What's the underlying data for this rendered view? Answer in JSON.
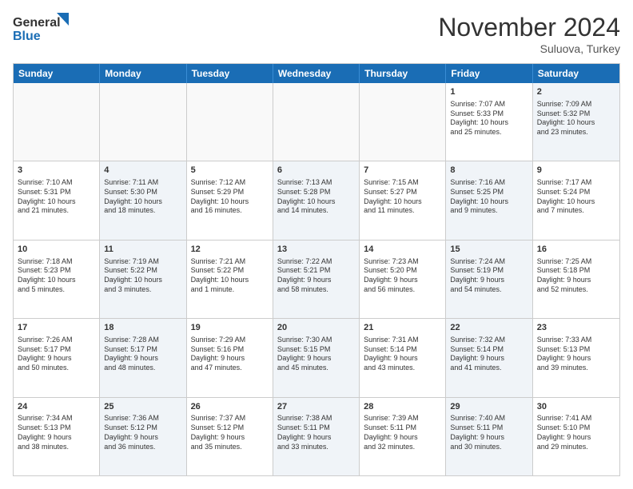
{
  "logo": {
    "line1": "General",
    "line2": "Blue"
  },
  "header": {
    "month": "November 2024",
    "location": "Suluova, Turkey"
  },
  "weekdays": [
    "Sunday",
    "Monday",
    "Tuesday",
    "Wednesday",
    "Thursday",
    "Friday",
    "Saturday"
  ],
  "rows": [
    [
      {
        "day": "",
        "info": "",
        "empty": true
      },
      {
        "day": "",
        "info": "",
        "empty": true
      },
      {
        "day": "",
        "info": "",
        "empty": true
      },
      {
        "day": "",
        "info": "",
        "empty": true
      },
      {
        "day": "",
        "info": "",
        "empty": true
      },
      {
        "day": "1",
        "info": "Sunrise: 7:07 AM\nSunset: 5:33 PM\nDaylight: 10 hours\nand 25 minutes.",
        "empty": false,
        "alt": false
      },
      {
        "day": "2",
        "info": "Sunrise: 7:09 AM\nSunset: 5:32 PM\nDaylight: 10 hours\nand 23 minutes.",
        "empty": false,
        "alt": true
      }
    ],
    [
      {
        "day": "3",
        "info": "Sunrise: 7:10 AM\nSunset: 5:31 PM\nDaylight: 10 hours\nand 21 minutes.",
        "empty": false,
        "alt": false
      },
      {
        "day": "4",
        "info": "Sunrise: 7:11 AM\nSunset: 5:30 PM\nDaylight: 10 hours\nand 18 minutes.",
        "empty": false,
        "alt": true
      },
      {
        "day": "5",
        "info": "Sunrise: 7:12 AM\nSunset: 5:29 PM\nDaylight: 10 hours\nand 16 minutes.",
        "empty": false,
        "alt": false
      },
      {
        "day": "6",
        "info": "Sunrise: 7:13 AM\nSunset: 5:28 PM\nDaylight: 10 hours\nand 14 minutes.",
        "empty": false,
        "alt": true
      },
      {
        "day": "7",
        "info": "Sunrise: 7:15 AM\nSunset: 5:27 PM\nDaylight: 10 hours\nand 11 minutes.",
        "empty": false,
        "alt": false
      },
      {
        "day": "8",
        "info": "Sunrise: 7:16 AM\nSunset: 5:25 PM\nDaylight: 10 hours\nand 9 minutes.",
        "empty": false,
        "alt": true
      },
      {
        "day": "9",
        "info": "Sunrise: 7:17 AM\nSunset: 5:24 PM\nDaylight: 10 hours\nand 7 minutes.",
        "empty": false,
        "alt": false
      }
    ],
    [
      {
        "day": "10",
        "info": "Sunrise: 7:18 AM\nSunset: 5:23 PM\nDaylight: 10 hours\nand 5 minutes.",
        "empty": false,
        "alt": false
      },
      {
        "day": "11",
        "info": "Sunrise: 7:19 AM\nSunset: 5:22 PM\nDaylight: 10 hours\nand 3 minutes.",
        "empty": false,
        "alt": true
      },
      {
        "day": "12",
        "info": "Sunrise: 7:21 AM\nSunset: 5:22 PM\nDaylight: 10 hours\nand 1 minute.",
        "empty": false,
        "alt": false
      },
      {
        "day": "13",
        "info": "Sunrise: 7:22 AM\nSunset: 5:21 PM\nDaylight: 9 hours\nand 58 minutes.",
        "empty": false,
        "alt": true
      },
      {
        "day": "14",
        "info": "Sunrise: 7:23 AM\nSunset: 5:20 PM\nDaylight: 9 hours\nand 56 minutes.",
        "empty": false,
        "alt": false
      },
      {
        "day": "15",
        "info": "Sunrise: 7:24 AM\nSunset: 5:19 PM\nDaylight: 9 hours\nand 54 minutes.",
        "empty": false,
        "alt": true
      },
      {
        "day": "16",
        "info": "Sunrise: 7:25 AM\nSunset: 5:18 PM\nDaylight: 9 hours\nand 52 minutes.",
        "empty": false,
        "alt": false
      }
    ],
    [
      {
        "day": "17",
        "info": "Sunrise: 7:26 AM\nSunset: 5:17 PM\nDaylight: 9 hours\nand 50 minutes.",
        "empty": false,
        "alt": false
      },
      {
        "day": "18",
        "info": "Sunrise: 7:28 AM\nSunset: 5:17 PM\nDaylight: 9 hours\nand 48 minutes.",
        "empty": false,
        "alt": true
      },
      {
        "day": "19",
        "info": "Sunrise: 7:29 AM\nSunset: 5:16 PM\nDaylight: 9 hours\nand 47 minutes.",
        "empty": false,
        "alt": false
      },
      {
        "day": "20",
        "info": "Sunrise: 7:30 AM\nSunset: 5:15 PM\nDaylight: 9 hours\nand 45 minutes.",
        "empty": false,
        "alt": true
      },
      {
        "day": "21",
        "info": "Sunrise: 7:31 AM\nSunset: 5:14 PM\nDaylight: 9 hours\nand 43 minutes.",
        "empty": false,
        "alt": false
      },
      {
        "day": "22",
        "info": "Sunrise: 7:32 AM\nSunset: 5:14 PM\nDaylight: 9 hours\nand 41 minutes.",
        "empty": false,
        "alt": true
      },
      {
        "day": "23",
        "info": "Sunrise: 7:33 AM\nSunset: 5:13 PM\nDaylight: 9 hours\nand 39 minutes.",
        "empty": false,
        "alt": false
      }
    ],
    [
      {
        "day": "24",
        "info": "Sunrise: 7:34 AM\nSunset: 5:13 PM\nDaylight: 9 hours\nand 38 minutes.",
        "empty": false,
        "alt": false
      },
      {
        "day": "25",
        "info": "Sunrise: 7:36 AM\nSunset: 5:12 PM\nDaylight: 9 hours\nand 36 minutes.",
        "empty": false,
        "alt": true
      },
      {
        "day": "26",
        "info": "Sunrise: 7:37 AM\nSunset: 5:12 PM\nDaylight: 9 hours\nand 35 minutes.",
        "empty": false,
        "alt": false
      },
      {
        "day": "27",
        "info": "Sunrise: 7:38 AM\nSunset: 5:11 PM\nDaylight: 9 hours\nand 33 minutes.",
        "empty": false,
        "alt": true
      },
      {
        "day": "28",
        "info": "Sunrise: 7:39 AM\nSunset: 5:11 PM\nDaylight: 9 hours\nand 32 minutes.",
        "empty": false,
        "alt": false
      },
      {
        "day": "29",
        "info": "Sunrise: 7:40 AM\nSunset: 5:11 PM\nDaylight: 9 hours\nand 30 minutes.",
        "empty": false,
        "alt": true
      },
      {
        "day": "30",
        "info": "Sunrise: 7:41 AM\nSunset: 5:10 PM\nDaylight: 9 hours\nand 29 minutes.",
        "empty": false,
        "alt": false
      }
    ]
  ]
}
